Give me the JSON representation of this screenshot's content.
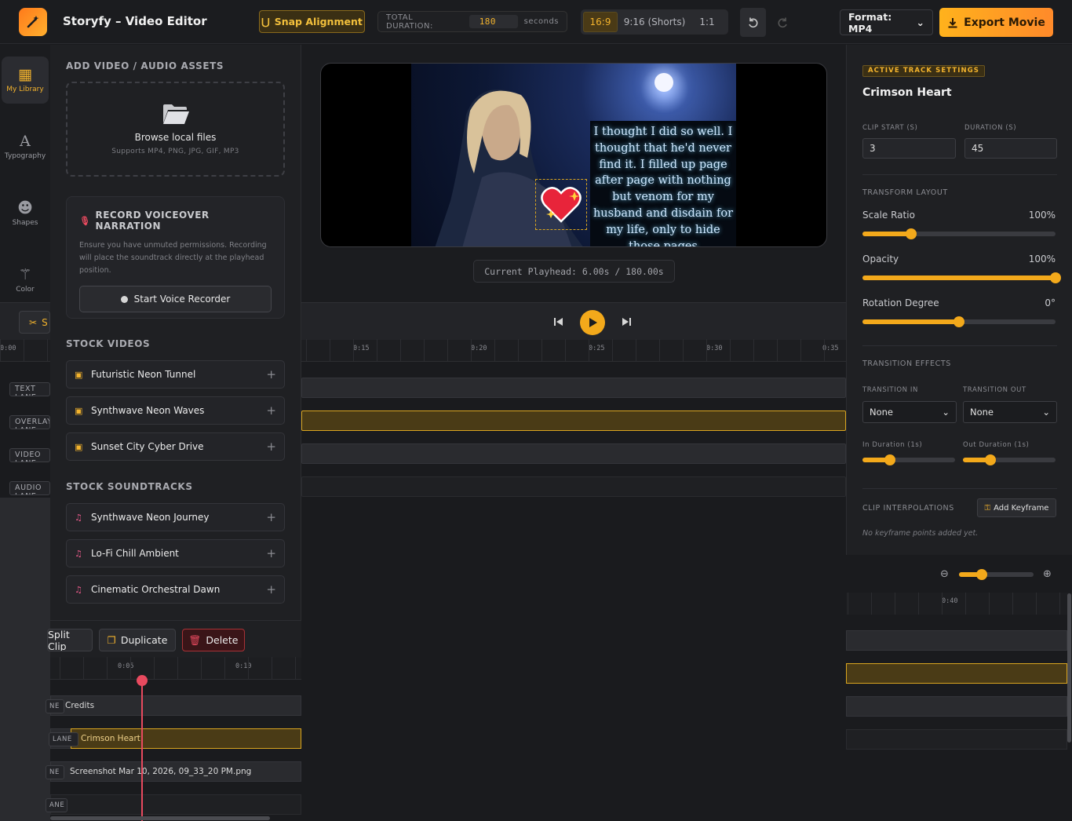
{
  "header": {
    "app_title": "Storyfy – Video Editor",
    "snap_label": "Snap Alignment",
    "total_duration_label": "TOTAL DURATION:",
    "total_duration_value": "180",
    "total_duration_unit": "seconds",
    "aspect_ratios": [
      "16:9",
      "9:16 (Shorts)",
      "1:1"
    ],
    "active_ratio": "16:9",
    "format_label": "Format: MP4",
    "export_label": "Export Movie"
  },
  "sidebar": {
    "items": [
      {
        "label": "My Library",
        "icon": "library-icon",
        "active": true
      },
      {
        "label": "Typography",
        "icon": "typography-icon",
        "active": false
      },
      {
        "label": "Shapes",
        "icon": "shapes-icon",
        "active": false
      },
      {
        "label": "Color",
        "icon": "magic-wand-icon",
        "active": false
      }
    ]
  },
  "assets": {
    "heading": "ADD VIDEO / AUDIO ASSETS",
    "browse_title": "Browse local files",
    "browse_sub": "Supports MP4, PNG, JPG, GIF, MP3",
    "voice_heading": "RECORD VOICEOVER NARRATION",
    "voice_desc": "Ensure you have unmuted permissions. Recording will place the soundtrack directly at the playhead position.",
    "voice_button": "Start Voice Recorder",
    "stock_videos_heading": "STOCK VIDEOS",
    "stock_videos": [
      "Futuristic Neon Tunnel",
      "Synthwave Neon Waves",
      "Sunset City Cyber Drive"
    ],
    "stock_soundtracks_heading": "STOCK SOUNDTRACKS",
    "stock_soundtracks": [
      "Synthwave Neon Journey",
      "Lo-Fi Chill Ambient",
      "Cinematic Orchestral Dawn"
    ]
  },
  "preview": {
    "caption": "I thought I did so well. I thought that he'd never find it. I filled up page after page with nothing but venom for my husband and disdain for my life, only to hide those pages",
    "playhead_text": "Current Playhead: 6.00s / 180.00s"
  },
  "timeline": {
    "ruler_labels": [
      "0:00",
      "0:15",
      "0:20",
      "0:25",
      "0:30",
      "0:35"
    ],
    "lanes": [
      "TEXT LANE",
      "OVERLAY LANE",
      "VIDEO LANE",
      "AUDIO LANE"
    ],
    "split_label": "Split Clip",
    "duplicate_label": "Duplicate",
    "delete_label": "Delete",
    "mini_ruler_labels": [
      "0:05",
      "0:10"
    ],
    "mini_lane_tags": [
      "NE",
      "LANE",
      "NE",
      "ANE"
    ],
    "clips": {
      "text": "Credits",
      "overlay_a": "Crimson Heart",
      "overlay_b": "Crimson Heart",
      "video": "Screenshot Mar 10, 2026, 09_33_20 PM.png"
    },
    "right_ruler_label": "0:40"
  },
  "properties": {
    "badge": "ACTIVE TRACK SETTINGS",
    "track_name": "Crimson Heart",
    "clip_start_label": "CLIP START (S)",
    "clip_start_value": "3",
    "duration_label": "DURATION (S)",
    "duration_value": "45",
    "transform_heading": "TRANSFORM LAYOUT",
    "scale_label": "Scale Ratio",
    "scale_value": "100%",
    "scale_level": 0.25,
    "opacity_label": "Opacity",
    "opacity_value": "100%",
    "opacity_level": 1.0,
    "rotation_label": "Rotation Degree",
    "rotation_value": "0°",
    "rotation_level": 0.5,
    "transition_heading": "TRANSITION EFFECTS",
    "transition_in_label": "TRANSITION IN",
    "transition_in_value": "None",
    "transition_out_label": "TRANSITION OUT",
    "transition_out_value": "None",
    "in_duration_label": "In Duration (1s)",
    "in_duration_level": 0.3,
    "out_duration_label": "Out Duration (1s)",
    "out_duration_level": 0.3,
    "interp_heading": "CLIP INTERPOLATIONS",
    "keyframe_button": "Add Keyframe",
    "no_keyframes": "No keyframe points added yet.",
    "zoom_level": 0.3
  },
  "colors": {
    "accent": "#f3a91b",
    "playhead": "#e84a5f",
    "background": "#1a1b1e",
    "danger": "#a83236"
  }
}
